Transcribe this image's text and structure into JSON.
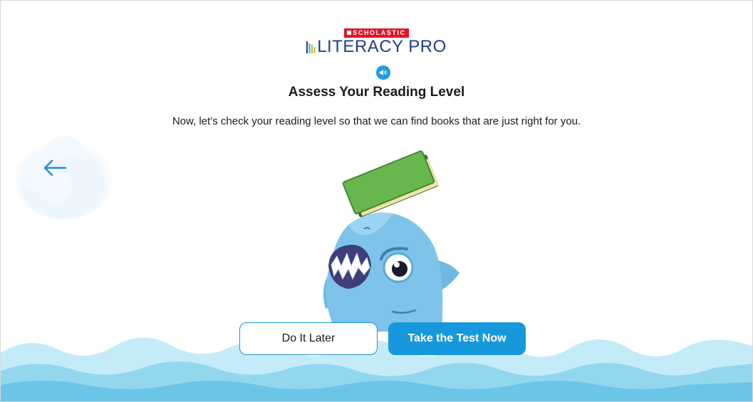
{
  "brand": {
    "publisher": "SCHOLASTIC",
    "product": "LITERACY PRO"
  },
  "audio_icon": "speaker-icon",
  "heading": {
    "title": "Assess Your Reading Level",
    "subtitle": "Now, let’s check your reading level so that we can find books that are just right for you."
  },
  "navigation": {
    "back_icon": "arrow-left-icon"
  },
  "actions": {
    "later_label": "Do It Later",
    "test_label": "Take the Test Now"
  },
  "colors": {
    "brand_red": "#e0152a",
    "brand_navy": "#243b8a",
    "accent_blue": "#1898dc",
    "water_light": "#bfeaf6",
    "water_mid": "#8fd6ee"
  }
}
